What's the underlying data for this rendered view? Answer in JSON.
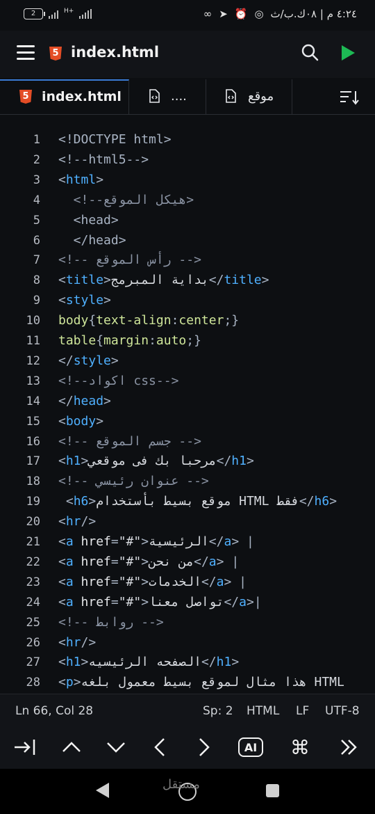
{
  "status_bar": {
    "battery": "2",
    "network": "H+",
    "time_date": "٤:٢٤ م | ٠٨ك.ب/ث"
  },
  "app_bar": {
    "title": "index.html",
    "icons": [
      "menu-icon",
      "html5-icon",
      "search-icon",
      "run-icon"
    ]
  },
  "tabs": [
    {
      "label": "index.html",
      "active": true
    },
    {
      "label": "....",
      "active": false
    },
    {
      "label": "موقع",
      "active": false
    }
  ],
  "code_lines": [
    {
      "n": "1",
      "parts": [
        [
          "pun",
          "<!DOCTYPE html>"
        ]
      ]
    },
    {
      "n": "2",
      "parts": [
        [
          "pun",
          "<!--html5-->"
        ]
      ]
    },
    {
      "n": "3",
      "parts": [
        [
          "pun",
          "<"
        ],
        [
          "tag",
          "html"
        ],
        [
          "pun",
          ">"
        ]
      ]
    },
    {
      "n": "4",
      "parts": [
        [
          "cm",
          "  <!--هيكل الموقع>"
        ]
      ]
    },
    {
      "n": "5",
      "parts": [
        [
          "pun",
          "  <head>"
        ]
      ]
    },
    {
      "n": "6",
      "parts": [
        [
          "pun",
          "  </head>"
        ]
      ]
    },
    {
      "n": "7",
      "parts": [
        [
          "cm",
          "<!-- رأس الموقع -->"
        ]
      ]
    },
    {
      "n": "8",
      "parts": [
        [
          "pun",
          "<"
        ],
        [
          "tag",
          "title"
        ],
        [
          "pun",
          ">"
        ],
        [
          "txt",
          "بداية المبرمج"
        ],
        [
          "pun",
          "</"
        ],
        [
          "tag",
          "title"
        ],
        [
          "pun",
          ">"
        ]
      ]
    },
    {
      "n": "9",
      "parts": [
        [
          "pun",
          "<"
        ],
        [
          "tag",
          "style"
        ],
        [
          "pun",
          ">"
        ]
      ]
    },
    {
      "n": "10",
      "parts": [
        [
          "css",
          "body"
        ],
        [
          "pun",
          "{"
        ],
        [
          "css",
          "text-align"
        ],
        [
          "pun",
          ":"
        ],
        [
          "css",
          "center"
        ],
        [
          "pun",
          ";}"
        ]
      ]
    },
    {
      "n": "11",
      "parts": [
        [
          "css",
          "table"
        ],
        [
          "pun",
          "{"
        ],
        [
          "css",
          "margin"
        ],
        [
          "pun",
          ":"
        ],
        [
          "css",
          "auto"
        ],
        [
          "pun",
          ";}"
        ]
      ]
    },
    {
      "n": "12",
      "parts": [
        [
          "pun",
          "</"
        ],
        [
          "tag",
          "style"
        ],
        [
          "pun",
          ">"
        ]
      ]
    },
    {
      "n": "13",
      "parts": [
        [
          "cm",
          "<!--اكواد css-->"
        ]
      ]
    },
    {
      "n": "14",
      "parts": [
        [
          "pun",
          "</"
        ],
        [
          "tag",
          "head"
        ],
        [
          "pun",
          ">"
        ]
      ]
    },
    {
      "n": "15",
      "parts": [
        [
          "pun",
          "<"
        ],
        [
          "tag",
          "body"
        ],
        [
          "pun",
          ">"
        ]
      ]
    },
    {
      "n": "16",
      "parts": [
        [
          "cm",
          "<!-- جسم الموقع -->"
        ]
      ]
    },
    {
      "n": "17",
      "parts": [
        [
          "pun",
          "<"
        ],
        [
          "tag",
          "h1"
        ],
        [
          "pun",
          ">"
        ],
        [
          "txt",
          "مرحبا بك فى موقعي"
        ],
        [
          "pun",
          "</"
        ],
        [
          "tag",
          "h1"
        ],
        [
          "pun",
          ">"
        ]
      ]
    },
    {
      "n": "18",
      "parts": [
        [
          "cm",
          "<!-- عنوان رئيسي -->"
        ]
      ]
    },
    {
      "n": "19",
      "parts": [
        [
          "pun",
          " <"
        ],
        [
          "tag",
          "h6"
        ],
        [
          "pun",
          ">"
        ],
        [
          "txt",
          "موقع بسيط بأستخدام HTML فقط"
        ],
        [
          "pun",
          "</"
        ],
        [
          "tag",
          "h6"
        ],
        [
          "pun",
          ">"
        ]
      ]
    },
    {
      "n": "20",
      "parts": [
        [
          "pun",
          "<"
        ],
        [
          "tag",
          "hr"
        ],
        [
          "pun",
          "/>"
        ]
      ]
    },
    {
      "n": "21",
      "parts": [
        [
          "pun",
          "<"
        ],
        [
          "tag",
          "a"
        ],
        [
          "attr",
          " href"
        ],
        [
          "pun",
          "="
        ],
        [
          "str",
          "\"#\""
        ],
        [
          "pun",
          ">"
        ],
        [
          "txt",
          "الرئيسية"
        ],
        [
          "pun",
          "</"
        ],
        [
          "tag",
          "a"
        ],
        [
          "pun",
          "> |"
        ]
      ]
    },
    {
      "n": "22",
      "parts": [
        [
          "pun",
          "<"
        ],
        [
          "tag",
          "a"
        ],
        [
          "attr",
          " href"
        ],
        [
          "pun",
          "="
        ],
        [
          "str",
          "\"#\""
        ],
        [
          "pun",
          ">"
        ],
        [
          "txt",
          "من نحن"
        ],
        [
          "pun",
          "</"
        ],
        [
          "tag",
          "a"
        ],
        [
          "pun",
          "> |"
        ]
      ]
    },
    {
      "n": "23",
      "parts": [
        [
          "pun",
          "<"
        ],
        [
          "tag",
          "a"
        ],
        [
          "attr",
          " href"
        ],
        [
          "pun",
          "="
        ],
        [
          "str",
          "\"#\""
        ],
        [
          "pun",
          ">"
        ],
        [
          "txt",
          "الخدمات"
        ],
        [
          "pun",
          "</"
        ],
        [
          "tag",
          "a"
        ],
        [
          "pun",
          "> |"
        ]
      ]
    },
    {
      "n": "24",
      "parts": [
        [
          "pun",
          "<"
        ],
        [
          "tag",
          "a"
        ],
        [
          "attr",
          " href"
        ],
        [
          "pun",
          "="
        ],
        [
          "str",
          "\"#\""
        ],
        [
          "pun",
          ">"
        ],
        [
          "txt",
          "تواصل معنا"
        ],
        [
          "pun",
          "</"
        ],
        [
          "tag",
          "a"
        ],
        [
          "pun",
          ">|"
        ]
      ]
    },
    {
      "n": "25",
      "parts": [
        [
          "cm",
          "<!-- روابط -->"
        ]
      ]
    },
    {
      "n": "26",
      "parts": [
        [
          "pun",
          "<"
        ],
        [
          "tag",
          "hr"
        ],
        [
          "pun",
          "/>"
        ]
      ]
    },
    {
      "n": "27",
      "parts": [
        [
          "pun",
          "<"
        ],
        [
          "tag",
          "h1"
        ],
        [
          "pun",
          ">"
        ],
        [
          "txt",
          "الصفحه الرئيسيه"
        ],
        [
          "pun",
          "</"
        ],
        [
          "tag",
          "h1"
        ],
        [
          "pun",
          ">"
        ]
      ]
    },
    {
      "n": "28",
      "parts": [
        [
          "pun",
          "<"
        ],
        [
          "tag",
          "p"
        ],
        [
          "pun",
          ">"
        ],
        [
          "txt",
          "هذا مثال لموقع بسيط معمول بلغه HTML"
        ]
      ]
    }
  ],
  "status_line": {
    "position": "Ln 66, Col 28",
    "spaces": "Sp: 2",
    "language": "HTML",
    "line_ending": "LF",
    "encoding": "UTF-8"
  },
  "key_bar": {
    "keys": [
      "tab-icon",
      "caret-up-icon",
      "caret-down-icon",
      "caret-left-icon",
      "caret-right-icon",
      "ai-icon",
      "command-icon",
      "more-icon"
    ],
    "ai_label": "AI"
  },
  "watermark": "مستقل"
}
